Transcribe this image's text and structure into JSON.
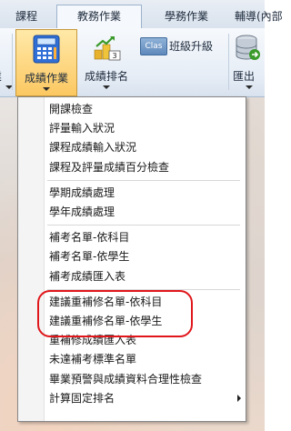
{
  "tabs": [
    "課程",
    "教務作業",
    "學務作業",
    "輔導(內部"
  ],
  "ribbon": {
    "left_cut_label": "業",
    "grades_label": "成績作業",
    "ranking_label": "成績排名",
    "upgrade_label": "班級升級",
    "upgrade_badge": "Clas",
    "export_label": "匯出",
    "ranking_badge": "3"
  },
  "menu": {
    "groups": [
      [
        "開課檢查",
        "評量輸入狀況",
        "課程成績輸入狀況",
        "課程及評量成績百分檢查"
      ],
      [
        "學期成績處理",
        "學年成績處理"
      ],
      [
        "補考名單-依科目",
        "補考名單-依學生",
        "補考成績匯入表"
      ],
      [
        "建議重補修名單-依科目",
        "建議重補修名單-依學生",
        "重補修成績匯入表",
        "未達補考標準名單",
        "畢業預警與成績資料合理性檢查",
        "計算固定排名"
      ]
    ]
  },
  "colors": {
    "highlight_ring": "#e0161b",
    "active_button": "#fcc862"
  }
}
